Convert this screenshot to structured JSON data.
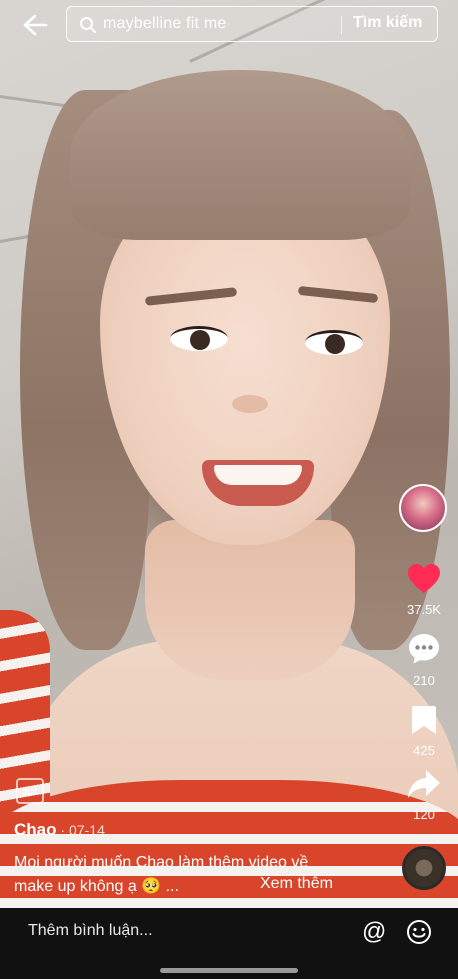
{
  "search": {
    "query": "maybelline fit me",
    "submit_label": "Tìm kiếm"
  },
  "rail": {
    "likes": "37.5K",
    "comments": "210",
    "saves": "425",
    "shares": "120"
  },
  "post": {
    "username": "Chao",
    "date": "· 07-14",
    "description": "Mọi người muốn Chao làm thêm video về make up không ạ 🥺 ...",
    "see_more": "Xem thêm"
  },
  "comment": {
    "placeholder": "Thêm bình luận..."
  },
  "icons": {
    "back": "back-arrow-icon",
    "search": "search-icon",
    "like": "heart-icon",
    "comment": "comment-icon",
    "save": "bookmark-icon",
    "share": "share-icon",
    "mention": "at-icon",
    "emoji": "emoji-icon"
  },
  "colors": {
    "like": "#fe2c55",
    "comment_bar": "#111111"
  }
}
